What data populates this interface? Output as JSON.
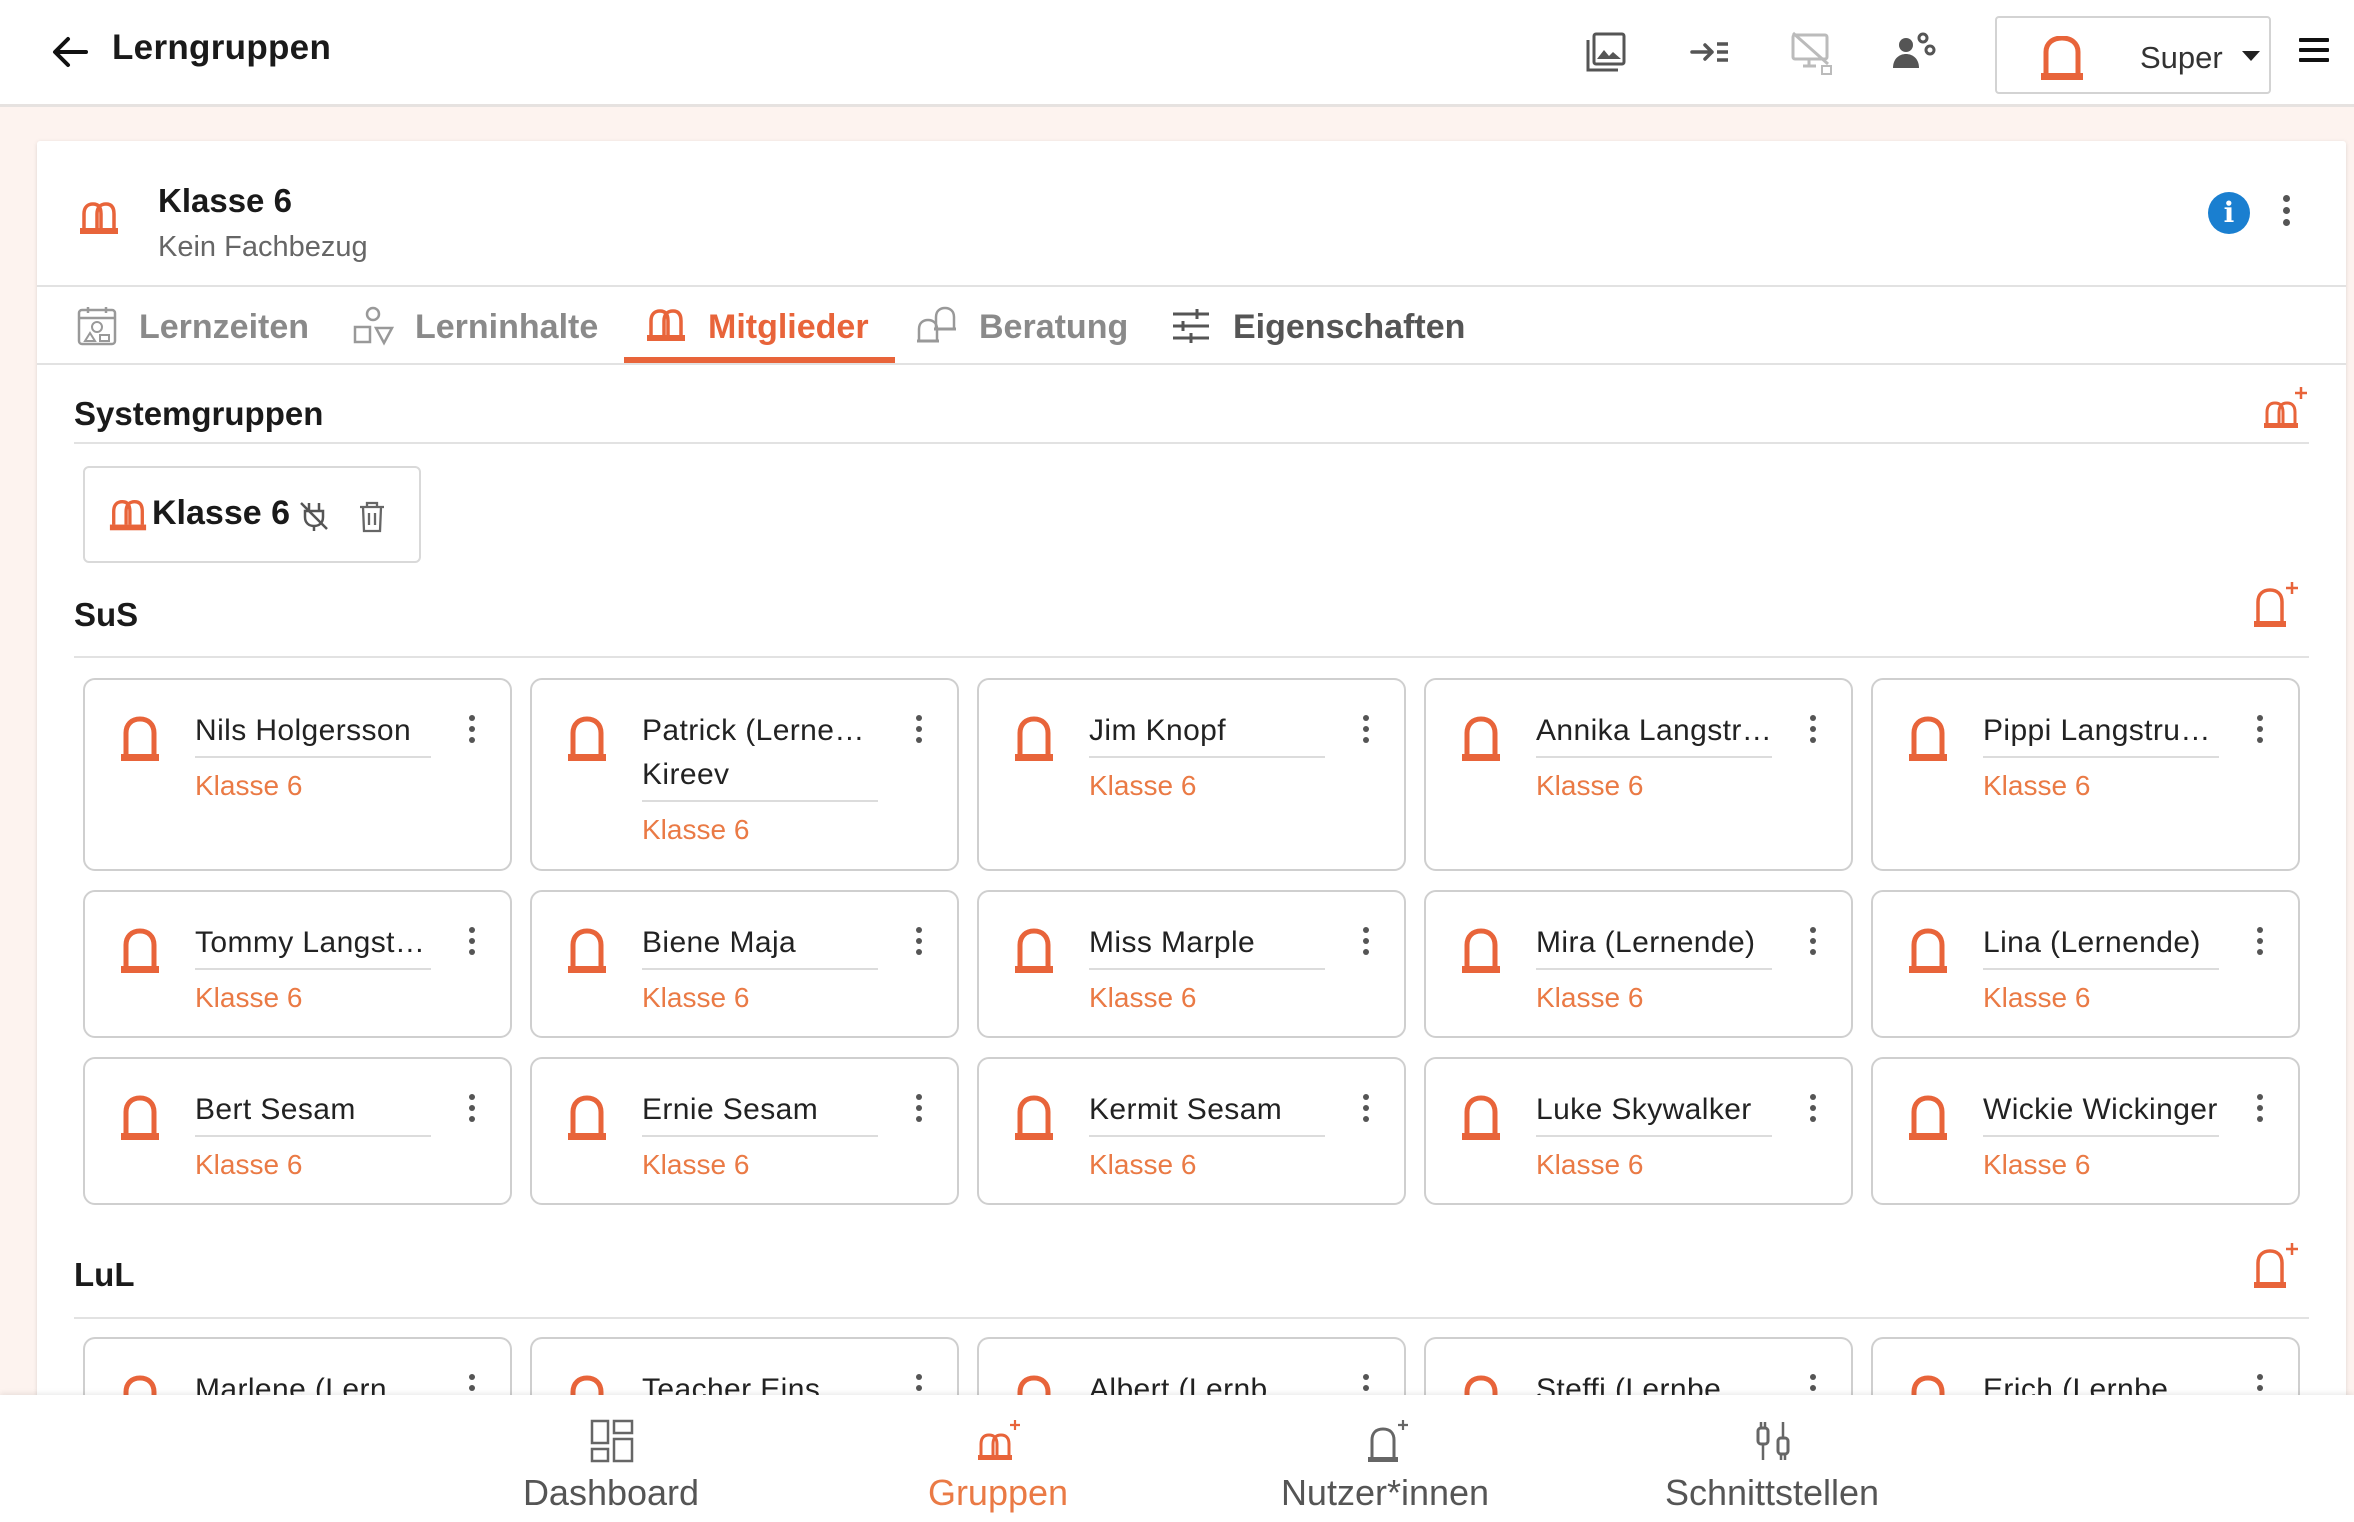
{
  "header": {
    "title": "Lerngruppen",
    "role_label": "Super"
  },
  "group": {
    "title": "Klasse 6",
    "subtitle": "Kein Fachbezug"
  },
  "tabs": [
    {
      "label": "Lernzeiten",
      "icon": "calendar-icon"
    },
    {
      "label": "Lerninhalte",
      "icon": "shapes-icon"
    },
    {
      "label": "Mitglieder",
      "icon": "group-icon",
      "active": true
    },
    {
      "label": "Beratung",
      "icon": "counseling-icon"
    },
    {
      "label": "Eigenschaften",
      "icon": "sliders-icon"
    }
  ],
  "sections": {
    "system": {
      "title": "Systemgruppen",
      "chip_label": "Klasse 6"
    },
    "students": {
      "title": "SuS"
    },
    "teachers": {
      "title": "LuL"
    }
  },
  "students": [
    {
      "name": "Nils Holgersson",
      "class": "Klasse 6"
    },
    {
      "name": "Patrick (Lernende)",
      "name2": "Kireev",
      "class": "Klasse 6"
    },
    {
      "name": "Jim Knopf",
      "class": "Klasse 6"
    },
    {
      "name": "Annika Langstrumpf",
      "class": "Klasse 6"
    },
    {
      "name": "Pippi Langstrumpf",
      "class": "Klasse 6"
    },
    {
      "name": "Tommy Langstrumpf",
      "class": "Klasse 6"
    },
    {
      "name": "Biene Maja",
      "class": "Klasse 6"
    },
    {
      "name": "Miss Marple",
      "class": "Klasse 6"
    },
    {
      "name": "Mira (Lernende)",
      "class": "Klasse 6"
    },
    {
      "name": "Lina (Lernende)",
      "class": "Klasse 6"
    },
    {
      "name": "Bert Sesam",
      "class": "Klasse 6"
    },
    {
      "name": "Ernie Sesam",
      "class": "Klasse 6"
    },
    {
      "name": "Kermit Sesam",
      "class": "Klasse 6"
    },
    {
      "name": "Luke Skywalker",
      "class": "Klasse 6"
    },
    {
      "name": "Wickie Wickinger",
      "class": "Klasse 6"
    }
  ],
  "teachers": [
    {
      "name": "Marlene (Lern"
    },
    {
      "name": "Teacher Eins"
    },
    {
      "name": "Albert (Lernb"
    },
    {
      "name": "Steffi (Lernbe"
    },
    {
      "name": "Erich (Lernbe"
    }
  ],
  "bottom_nav": [
    {
      "label": "Dashboard",
      "icon": "dashboard-icon"
    },
    {
      "label": "Gruppen",
      "icon": "groups-icon",
      "active": true
    },
    {
      "label": "Nutzer*innen",
      "icon": "users-icon"
    },
    {
      "label": "Schnittstellen",
      "icon": "interfaces-icon"
    }
  ],
  "colors": {
    "accent": "#e8643a",
    "accent_text": "#ea7a45",
    "info": "#1a7fd0",
    "page_bg": "#fdf3ef"
  }
}
